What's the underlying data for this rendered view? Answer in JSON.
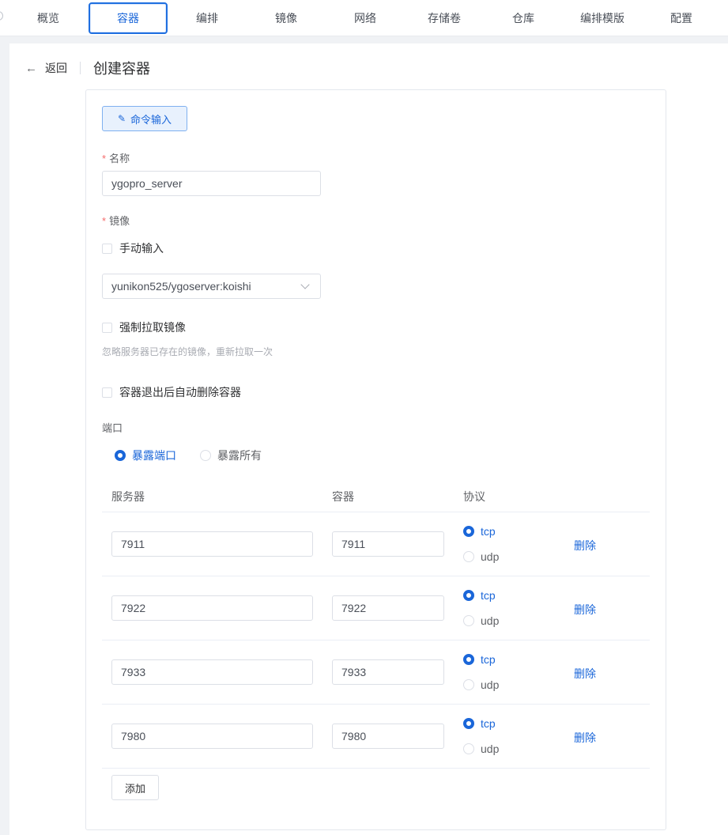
{
  "nav": {
    "tabs": [
      {
        "label": "概览",
        "active": false
      },
      {
        "label": "容器",
        "active": true
      },
      {
        "label": "编排",
        "active": false
      },
      {
        "label": "镜像",
        "active": false
      },
      {
        "label": "网络",
        "active": false
      },
      {
        "label": "存储卷",
        "active": false
      },
      {
        "label": "仓库",
        "active": false
      },
      {
        "label": "编排模版",
        "active": false
      },
      {
        "label": "配置",
        "active": false
      }
    ]
  },
  "header": {
    "back_label": "返回",
    "title": "创建容器"
  },
  "form": {
    "command_button": "命令输入",
    "name_label": "名称",
    "name_value": "ygopro_server",
    "image_label": "镜像",
    "manual_input_label": "手动输入",
    "image_value": "yunikon525/ygoserver:koishi",
    "force_pull_label": "强制拉取镜像",
    "force_pull_hint": "忽略服务器已存在的镜像，重新拉取一次",
    "auto_remove_label": "容器退出后自动删除容器",
    "ports_label": "端口",
    "expose_ports_label": "暴露端口",
    "expose_all_label": "暴露所有",
    "port_mode": "expose_ports"
  },
  "ports_table": {
    "headers": [
      "服务器",
      "容器",
      "协议"
    ],
    "delete_label": "删除",
    "tcp_label": "tcp",
    "udp_label": "udp",
    "rows": [
      {
        "server": "7911",
        "container": "7911",
        "protocol": "tcp"
      },
      {
        "server": "7922",
        "container": "7922",
        "protocol": "tcp"
      },
      {
        "server": "7933",
        "container": "7933",
        "protocol": "tcp"
      },
      {
        "server": "7980",
        "container": "7980",
        "protocol": "tcp"
      }
    ],
    "add_label": "添加"
  },
  "colors": {
    "primary": "#1a66d9",
    "required": "#f56c6c"
  }
}
